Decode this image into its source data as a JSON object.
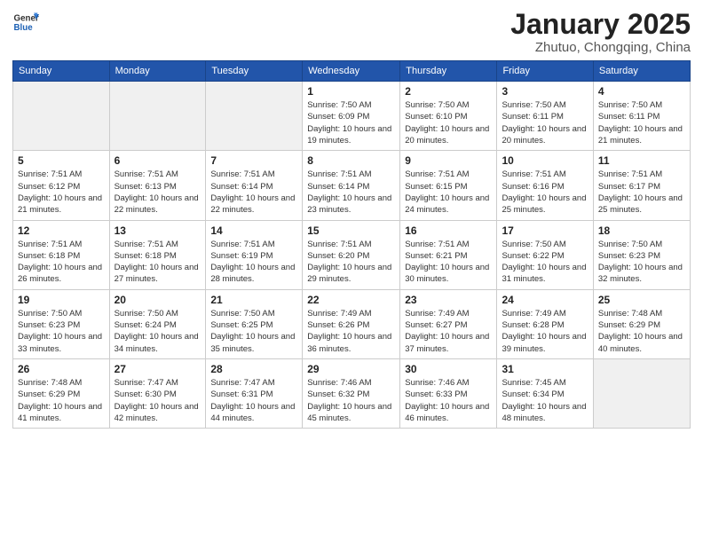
{
  "header": {
    "logo_general": "General",
    "logo_blue": "Blue",
    "title": "January 2025",
    "subtitle": "Zhutuo, Chongqing, China"
  },
  "weekdays": [
    "Sunday",
    "Monday",
    "Tuesday",
    "Wednesday",
    "Thursday",
    "Friday",
    "Saturday"
  ],
  "weeks": [
    [
      {
        "day": "",
        "empty": true
      },
      {
        "day": "",
        "empty": true
      },
      {
        "day": "",
        "empty": true
      },
      {
        "day": "1",
        "sunrise": "7:50 AM",
        "sunset": "6:09 PM",
        "daylight": "10 hours and 19 minutes."
      },
      {
        "day": "2",
        "sunrise": "7:50 AM",
        "sunset": "6:10 PM",
        "daylight": "10 hours and 20 minutes."
      },
      {
        "day": "3",
        "sunrise": "7:50 AM",
        "sunset": "6:11 PM",
        "daylight": "10 hours and 20 minutes."
      },
      {
        "day": "4",
        "sunrise": "7:50 AM",
        "sunset": "6:11 PM",
        "daylight": "10 hours and 21 minutes."
      }
    ],
    [
      {
        "day": "5",
        "sunrise": "7:51 AM",
        "sunset": "6:12 PM",
        "daylight": "10 hours and 21 minutes."
      },
      {
        "day": "6",
        "sunrise": "7:51 AM",
        "sunset": "6:13 PM",
        "daylight": "10 hours and 22 minutes."
      },
      {
        "day": "7",
        "sunrise": "7:51 AM",
        "sunset": "6:14 PM",
        "daylight": "10 hours and 22 minutes."
      },
      {
        "day": "8",
        "sunrise": "7:51 AM",
        "sunset": "6:14 PM",
        "daylight": "10 hours and 23 minutes."
      },
      {
        "day": "9",
        "sunrise": "7:51 AM",
        "sunset": "6:15 PM",
        "daylight": "10 hours and 24 minutes."
      },
      {
        "day": "10",
        "sunrise": "7:51 AM",
        "sunset": "6:16 PM",
        "daylight": "10 hours and 25 minutes."
      },
      {
        "day": "11",
        "sunrise": "7:51 AM",
        "sunset": "6:17 PM",
        "daylight": "10 hours and 25 minutes."
      }
    ],
    [
      {
        "day": "12",
        "sunrise": "7:51 AM",
        "sunset": "6:18 PM",
        "daylight": "10 hours and 26 minutes."
      },
      {
        "day": "13",
        "sunrise": "7:51 AM",
        "sunset": "6:18 PM",
        "daylight": "10 hours and 27 minutes."
      },
      {
        "day": "14",
        "sunrise": "7:51 AM",
        "sunset": "6:19 PM",
        "daylight": "10 hours and 28 minutes."
      },
      {
        "day": "15",
        "sunrise": "7:51 AM",
        "sunset": "6:20 PM",
        "daylight": "10 hours and 29 minutes."
      },
      {
        "day": "16",
        "sunrise": "7:51 AM",
        "sunset": "6:21 PM",
        "daylight": "10 hours and 30 minutes."
      },
      {
        "day": "17",
        "sunrise": "7:50 AM",
        "sunset": "6:22 PM",
        "daylight": "10 hours and 31 minutes."
      },
      {
        "day": "18",
        "sunrise": "7:50 AM",
        "sunset": "6:23 PM",
        "daylight": "10 hours and 32 minutes."
      }
    ],
    [
      {
        "day": "19",
        "sunrise": "7:50 AM",
        "sunset": "6:23 PM",
        "daylight": "10 hours and 33 minutes."
      },
      {
        "day": "20",
        "sunrise": "7:50 AM",
        "sunset": "6:24 PM",
        "daylight": "10 hours and 34 minutes."
      },
      {
        "day": "21",
        "sunrise": "7:50 AM",
        "sunset": "6:25 PM",
        "daylight": "10 hours and 35 minutes."
      },
      {
        "day": "22",
        "sunrise": "7:49 AM",
        "sunset": "6:26 PM",
        "daylight": "10 hours and 36 minutes."
      },
      {
        "day": "23",
        "sunrise": "7:49 AM",
        "sunset": "6:27 PM",
        "daylight": "10 hours and 37 minutes."
      },
      {
        "day": "24",
        "sunrise": "7:49 AM",
        "sunset": "6:28 PM",
        "daylight": "10 hours and 39 minutes."
      },
      {
        "day": "25",
        "sunrise": "7:48 AM",
        "sunset": "6:29 PM",
        "daylight": "10 hours and 40 minutes."
      }
    ],
    [
      {
        "day": "26",
        "sunrise": "7:48 AM",
        "sunset": "6:29 PM",
        "daylight": "10 hours and 41 minutes."
      },
      {
        "day": "27",
        "sunrise": "7:47 AM",
        "sunset": "6:30 PM",
        "daylight": "10 hours and 42 minutes."
      },
      {
        "day": "28",
        "sunrise": "7:47 AM",
        "sunset": "6:31 PM",
        "daylight": "10 hours and 44 minutes."
      },
      {
        "day": "29",
        "sunrise": "7:46 AM",
        "sunset": "6:32 PM",
        "daylight": "10 hours and 45 minutes."
      },
      {
        "day": "30",
        "sunrise": "7:46 AM",
        "sunset": "6:33 PM",
        "daylight": "10 hours and 46 minutes."
      },
      {
        "day": "31",
        "sunrise": "7:45 AM",
        "sunset": "6:34 PM",
        "daylight": "10 hours and 48 minutes."
      },
      {
        "day": "",
        "empty": true
      }
    ]
  ],
  "labels": {
    "sunrise": "Sunrise:",
    "sunset": "Sunset:",
    "daylight": "Daylight:"
  }
}
